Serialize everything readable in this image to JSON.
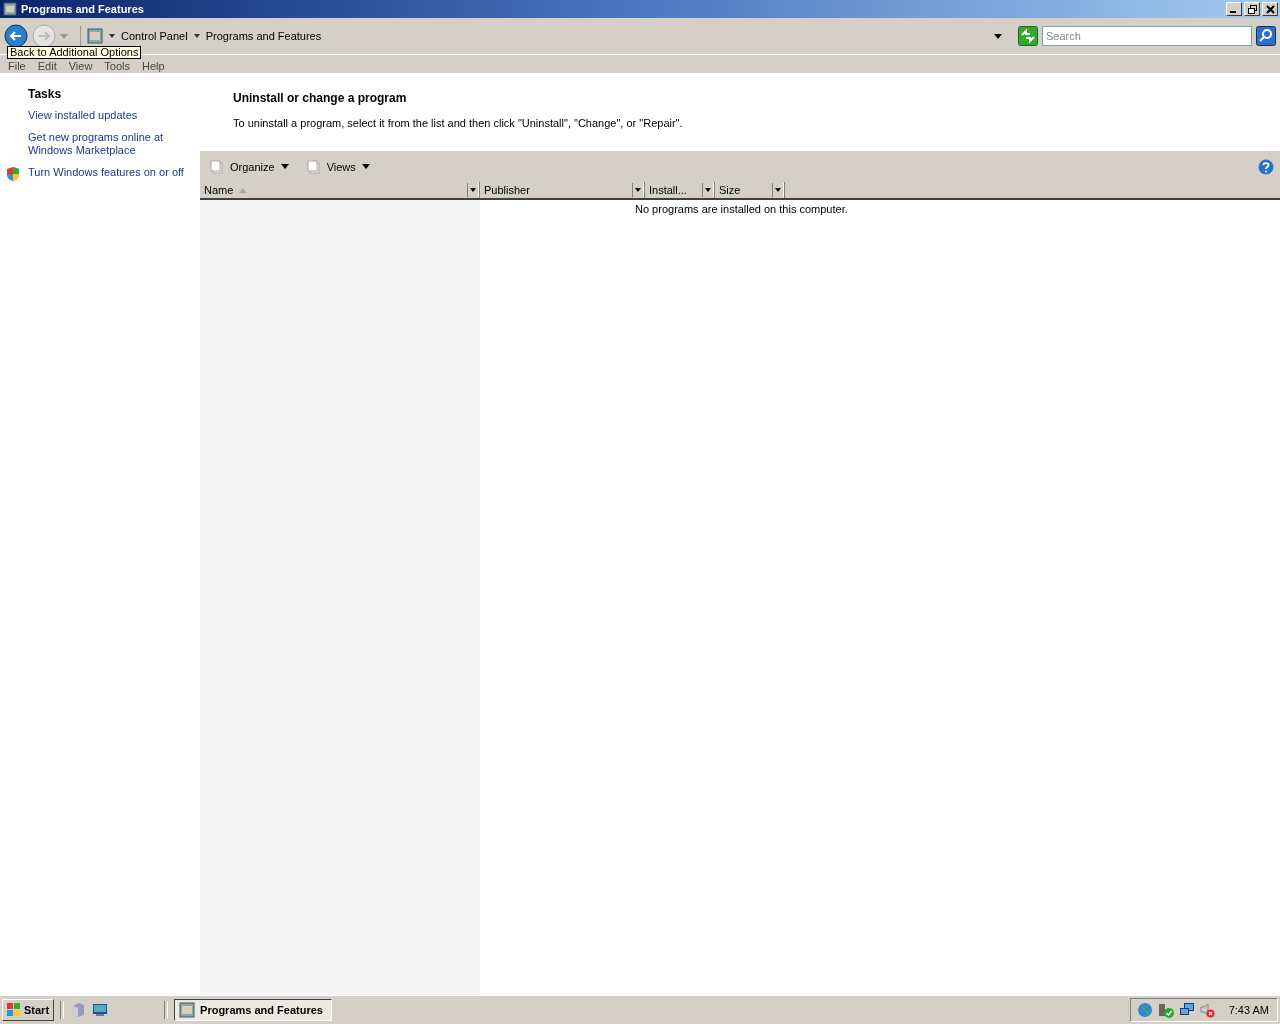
{
  "window": {
    "title": "Programs and Features"
  },
  "address_bar": {
    "breadcrumbs": [
      "Control Panel",
      "Programs and Features"
    ],
    "search": {
      "placeholder": "Search"
    }
  },
  "tooltip": "Back to Additional Options",
  "menu": [
    "File",
    "Edit",
    "View",
    "Tools",
    "Help"
  ],
  "tasks": {
    "title": "Tasks",
    "links": [
      {
        "label": "View installed updates",
        "kind": "link"
      },
      {
        "label": "Get new programs online at Windows Marketplace",
        "kind": "link"
      },
      {
        "label": "Turn Windows features on or off",
        "kind": "shield"
      }
    ]
  },
  "main": {
    "heading": "Uninstall or change a program",
    "description": "To uninstall a program, select it from the list and then click \"Uninstall\", \"Change\", or \"Repair\".",
    "toolbar": [
      "Organize",
      "Views"
    ],
    "columns": [
      {
        "label": "Name",
        "sorted": true
      },
      {
        "label": "Publisher",
        "sorted": false
      },
      {
        "label": "Install...",
        "sorted": false
      },
      {
        "label": "Size",
        "sorted": false
      }
    ],
    "empty_message": "No programs are installed on this computer."
  },
  "taskbar": {
    "start": "Start",
    "tasks": [
      {
        "label": "Programs and Features",
        "selected": true
      }
    ],
    "clock": "7:43 AM"
  }
}
